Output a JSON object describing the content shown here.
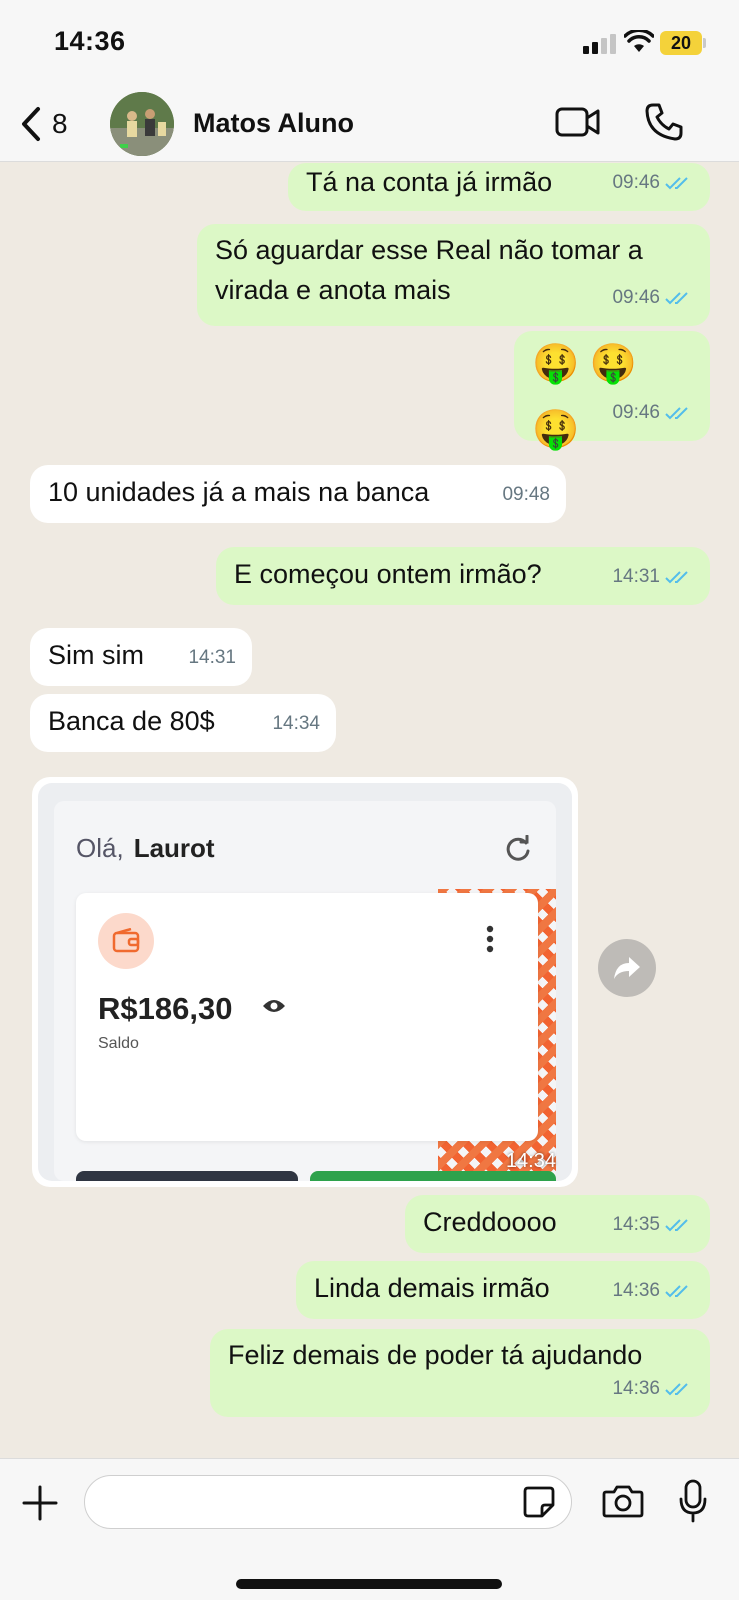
{
  "status_bar": {
    "time": "14:36",
    "battery": "20"
  },
  "header": {
    "back_count": "8",
    "contact_name": "Matos Aluno"
  },
  "messages": [
    {
      "dir": "out",
      "text": "Tá na conta já irmão",
      "time": "09:46"
    },
    {
      "dir": "out",
      "text": "Só aguardar esse Real não tomar a virada e anota mais",
      "time": "09:46"
    },
    {
      "dir": "out",
      "text": "🤑 🤑 🤑",
      "time": "09:46"
    },
    {
      "dir": "in",
      "text": "10 unidades já a mais na banca",
      "time": "09:48"
    },
    {
      "dir": "out",
      "text": "E começou ontem irmão?",
      "time": "14:31"
    },
    {
      "dir": "in",
      "text": "Sim sim",
      "time": "14:31"
    },
    {
      "dir": "in",
      "text": "Banca de 80$",
      "time": "14:34"
    },
    {
      "dir": "out",
      "text": "Creddoooo",
      "time": "14:35"
    },
    {
      "dir": "out",
      "text": "Linda demais irmão",
      "time": "14:36"
    },
    {
      "dir": "out",
      "text": "Feliz demais de poder tá ajudando",
      "time": "14:36"
    }
  ],
  "image_message": {
    "greeting": "Olá,",
    "user": "Laurot",
    "balance": "R$186,30",
    "balance_label": "Saldo",
    "time": "14:34"
  },
  "input": {
    "placeholder": ""
  },
  "colors": {
    "outgoing_bubble": "#dcf8c6",
    "incoming_bubble": "#ffffff",
    "read_ticks": "#53bdeb",
    "accent_orange": "#f06a2f"
  }
}
